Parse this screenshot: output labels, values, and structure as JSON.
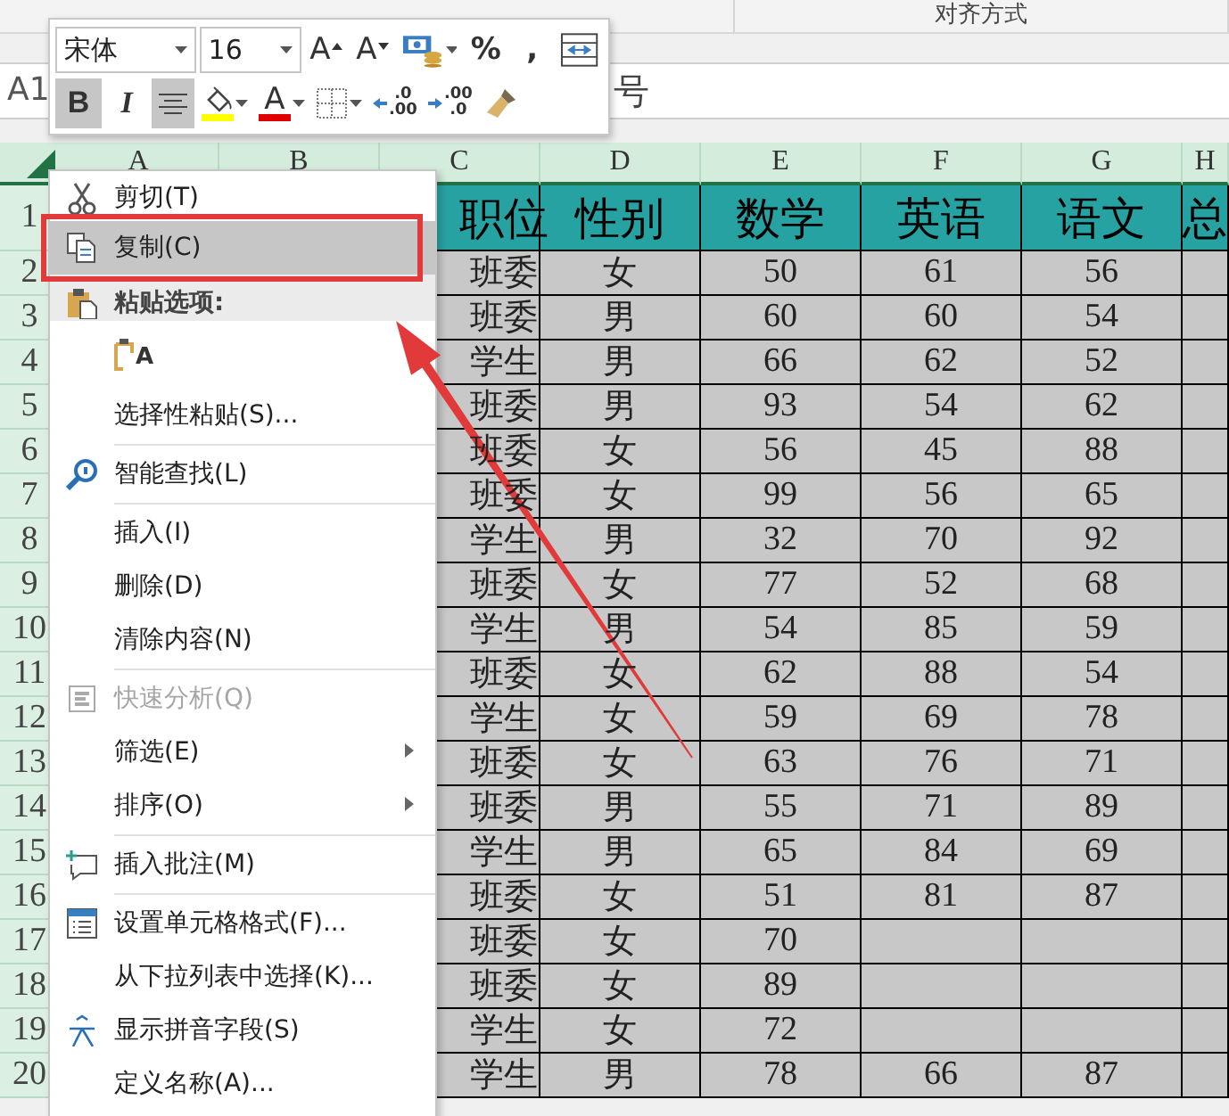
{
  "ribbon": {
    "groups": [
      {
        "label": "对齐方式"
      }
    ]
  },
  "formula_bar": {
    "name_box": "A1",
    "value": "号"
  },
  "mini_toolbar": {
    "font": "宋体",
    "size": "16",
    "row1": [
      {
        "kind": "grow-font",
        "text": "A"
      },
      {
        "kind": "shrink-font",
        "text": "A"
      },
      {
        "kind": "accounting"
      },
      {
        "kind": "percent",
        "text": "%"
      },
      {
        "kind": "comma",
        "text": ","
      },
      {
        "kind": "wrap"
      }
    ],
    "row2": [
      {
        "kind": "bold",
        "text": "B",
        "on": true
      },
      {
        "kind": "italic",
        "text": "I",
        "on": false
      },
      {
        "kind": "center",
        "on": true
      },
      {
        "kind": "fill-color",
        "color": "#ffff00"
      },
      {
        "kind": "font-color",
        "text": "A",
        "color": "#e00000"
      },
      {
        "kind": "borders"
      },
      {
        "kind": "increase-decimal",
        "lines": [
          ".0",
          ".00"
        ]
      },
      {
        "kind": "decrease-decimal",
        "lines": [
          ".00",
          ".0"
        ]
      },
      {
        "kind": "format-painter"
      }
    ]
  },
  "sheet": {
    "columns": [
      "A",
      "B",
      "C",
      "D",
      "E",
      "F",
      "G",
      "H"
    ],
    "rows": [
      {
        "number": "1",
        "kind": "header",
        "cells": [
          null,
          null,
          "职位",
          "性别",
          "数学",
          "英语",
          "语文",
          "总"
        ]
      },
      {
        "number": "2",
        "kind": "data",
        "cells": [
          null,
          null,
          "班委",
          "女",
          "50",
          "61",
          "56",
          null
        ]
      },
      {
        "number": "3",
        "kind": "data",
        "cells": [
          null,
          null,
          "班委",
          "男",
          "60",
          "60",
          "54",
          null
        ]
      },
      {
        "number": "4",
        "kind": "data",
        "cells": [
          null,
          null,
          "学生",
          "男",
          "66",
          "62",
          "52",
          null
        ]
      },
      {
        "number": "5",
        "kind": "data",
        "cells": [
          null,
          null,
          "班委",
          "男",
          "93",
          "54",
          "62",
          null
        ]
      },
      {
        "number": "6",
        "kind": "data",
        "cells": [
          null,
          null,
          "班委",
          "女",
          "56",
          "45",
          "88",
          null
        ]
      },
      {
        "number": "7",
        "kind": "data",
        "cells": [
          null,
          null,
          "班委",
          "女",
          "99",
          "56",
          "65",
          null
        ]
      },
      {
        "number": "8",
        "kind": "data",
        "cells": [
          null,
          null,
          "学生",
          "男",
          "32",
          "70",
          "92",
          null
        ]
      },
      {
        "number": "9",
        "kind": "data",
        "cells": [
          null,
          null,
          "班委",
          "女",
          "77",
          "52",
          "68",
          null
        ]
      },
      {
        "number": "10",
        "kind": "data",
        "cells": [
          null,
          null,
          "学生",
          "男",
          "54",
          "85",
          "59",
          null
        ]
      },
      {
        "number": "11",
        "kind": "data",
        "cells": [
          null,
          null,
          "班委",
          "女",
          "62",
          "88",
          "54",
          null
        ]
      },
      {
        "number": "12",
        "kind": "data",
        "cells": [
          null,
          null,
          "学生",
          "女",
          "59",
          "69",
          "78",
          null
        ]
      },
      {
        "number": "13",
        "kind": "data",
        "cells": [
          null,
          null,
          "班委",
          "女",
          "63",
          "76",
          "71",
          null
        ]
      },
      {
        "number": "14",
        "kind": "data",
        "cells": [
          null,
          null,
          "班委",
          "男",
          "55",
          "71",
          "89",
          null
        ]
      },
      {
        "number": "15",
        "kind": "data",
        "cells": [
          null,
          null,
          "学生",
          "男",
          "65",
          "84",
          "69",
          null
        ]
      },
      {
        "number": "16",
        "kind": "data",
        "cells": [
          null,
          null,
          "班委",
          "女",
          "51",
          "81",
          "87",
          null
        ]
      },
      {
        "number": "17",
        "kind": "data",
        "cells": [
          null,
          null,
          "班委",
          "女",
          "70",
          null,
          null,
          null
        ]
      },
      {
        "number": "18",
        "kind": "data",
        "cells": [
          null,
          null,
          "班委",
          "女",
          "89",
          null,
          null,
          null
        ]
      },
      {
        "number": "19",
        "kind": "data",
        "cells": [
          null,
          null,
          "学生",
          "女",
          "72",
          null,
          null,
          null
        ]
      },
      {
        "number": "20",
        "kind": "data",
        "cells": [
          null,
          null,
          "学生",
          "男",
          "78",
          "66",
          "87",
          null
        ]
      }
    ]
  },
  "context_menu": {
    "items": [
      {
        "kind": "cut",
        "label": "剪切(T)",
        "selected": false,
        "disabled": false
      },
      {
        "kind": "copy",
        "label": "复制(C)",
        "selected": true,
        "disabled": false
      },
      {
        "kind": "paste-header",
        "label": "粘贴选项:"
      },
      {
        "kind": "paste-option",
        "text": "A"
      },
      {
        "kind": "command",
        "label": "选择性粘贴(S)...",
        "selected": false,
        "disabled": false
      },
      {
        "kind": "separator"
      },
      {
        "kind": "search",
        "label": "智能查找(L)",
        "selected": false,
        "disabled": false
      },
      {
        "kind": "separator"
      },
      {
        "kind": "command",
        "label": "插入(I)",
        "selected": false,
        "disabled": false
      },
      {
        "kind": "command",
        "label": "删除(D)",
        "selected": false,
        "disabled": false
      },
      {
        "kind": "command",
        "label": "清除内容(N)",
        "selected": false,
        "disabled": false
      },
      {
        "kind": "separator"
      },
      {
        "kind": "quick-analysis",
        "label": "快速分析(Q)",
        "selected": false,
        "disabled": true
      },
      {
        "kind": "submenu",
        "label": "筛选(E)",
        "selected": false,
        "disabled": false
      },
      {
        "kind": "submenu",
        "label": "排序(O)",
        "selected": false,
        "disabled": false
      },
      {
        "kind": "separator"
      },
      {
        "kind": "comment",
        "label": "插入批注(M)",
        "selected": false,
        "disabled": false
      },
      {
        "kind": "separator"
      },
      {
        "kind": "format-cells",
        "label": "设置单元格格式(F)...",
        "selected": false,
        "disabled": false
      },
      {
        "kind": "command",
        "label": "从下拉列表中选择(K)...",
        "selected": false,
        "disabled": false
      },
      {
        "kind": "phonetic",
        "label": "显示拼音字段(S)",
        "selected": false,
        "disabled": false
      },
      {
        "kind": "command",
        "label": "定义名称(A)...",
        "selected": false,
        "disabled": false
      }
    ]
  },
  "annotations": {
    "frame": true,
    "arrow": true
  }
}
